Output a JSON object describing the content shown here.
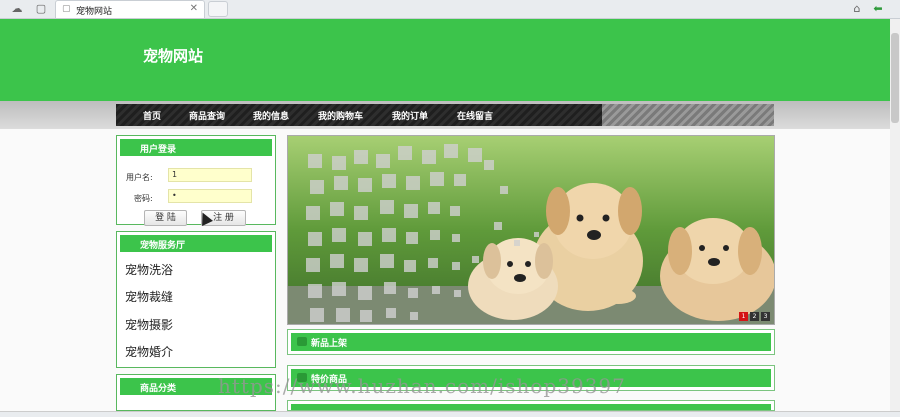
{
  "browser": {
    "tab_title": "宠物网站",
    "tab_close": "✕",
    "back_arrow": "⬅",
    "home_icon": "⌂",
    "doc_icon": "▢",
    "cloud_icon": "☁"
  },
  "site": {
    "title": "宠物网站"
  },
  "nav": {
    "items": [
      "首页",
      "商品查询",
      "我的信息",
      "我的购物车",
      "我的订单",
      "在线留言"
    ]
  },
  "login": {
    "header": "用户登录",
    "username_label": "用户名:",
    "username_value": "1",
    "password_label": "密码:",
    "password_value": "•",
    "login_button": "登 陆",
    "register_button": "注 册"
  },
  "services": {
    "header": "宠物服务厅",
    "items": [
      "宠物洗浴",
      "宠物裁缝",
      "宠物摄影",
      "宠物婚介"
    ]
  },
  "categories": {
    "header": "商品分类"
  },
  "banner": {
    "pages": [
      "1",
      "2",
      "3"
    ],
    "active_page": "1"
  },
  "sections": {
    "new_products": "新品上架",
    "special_products": "特价商品"
  },
  "watermark": "https://www.huzhan.com/ishop39397",
  "colors": {
    "brand_green": "#3cc44b",
    "nav_dark": "#1f1f1f",
    "input_bg": "#ffffcc",
    "active_dot": "#d41414"
  }
}
